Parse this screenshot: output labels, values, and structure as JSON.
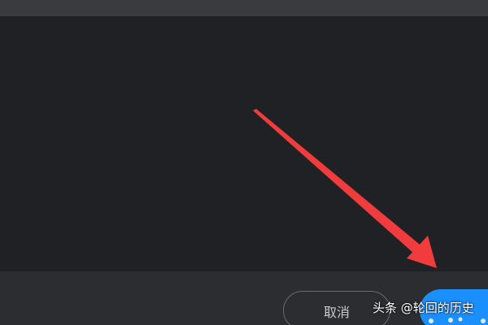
{
  "dialog": {
    "cancel_label": "取消"
  },
  "watermark": {
    "text": "头条 @轮回的历史"
  },
  "colors": {
    "background": "#202124",
    "top_bar": "#3a3b3e",
    "bottom_bar": "#2c2d30",
    "confirm_button": "#1a90ff",
    "arrow": "#f03c3c"
  }
}
